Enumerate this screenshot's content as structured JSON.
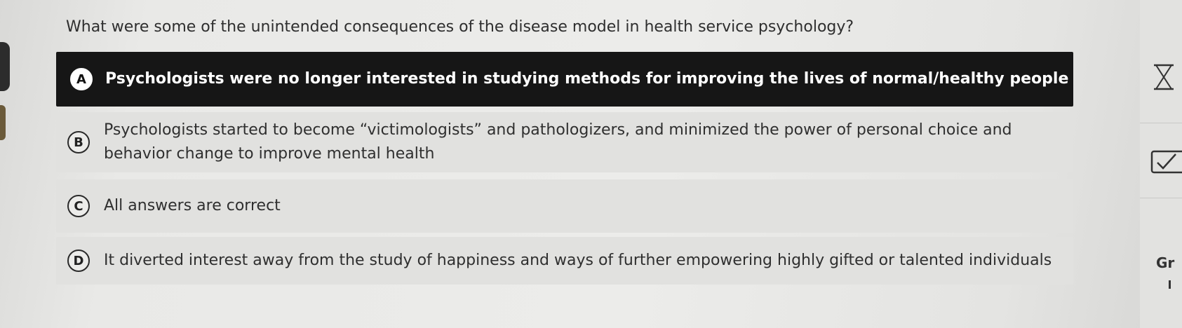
{
  "question": "What were some of the unintended consequences of the disease model in health service psychology?",
  "options": [
    {
      "letter": "A",
      "text": "Psychologists were no longer interested in studying methods for improving the lives of normal/healthy people",
      "selected": true
    },
    {
      "letter": "B",
      "text_line1": "Psychologists started to become “victimologists” and pathologizers, and minimized the power of personal choice and",
      "text_line2": "behavior change to improve mental health",
      "selected": false
    },
    {
      "letter": "C",
      "text": "All answers are correct",
      "selected": false
    },
    {
      "letter": "D",
      "text": "It diverted interest away from the study of happiness and ways of further empowering highly gifted or talented individuals",
      "selected": false
    }
  ],
  "sidebar": {
    "icons": [
      "hourglass-icon",
      "checkbox-icon"
    ],
    "partial_label": "Gr"
  },
  "colors": {
    "selected_bg": "#161616",
    "option_bg": "#e1e1df",
    "page_bg": "#e9e9e7"
  }
}
